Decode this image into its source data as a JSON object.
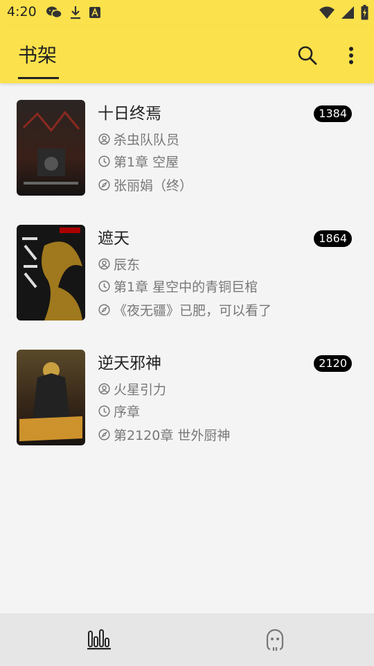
{
  "status_bar": {
    "time": "4:20",
    "left_icons": [
      "wechat-icon",
      "download-icon",
      "text-app-icon"
    ],
    "right_icons": [
      "wifi-icon",
      "signal-icon",
      "battery-charging-icon"
    ]
  },
  "app_bar": {
    "tab_label": "书架",
    "actions": [
      "search-icon",
      "more-vert-icon"
    ],
    "accent_color": "#fbe14b"
  },
  "books": [
    {
      "title": "十日终焉",
      "unread_count": "1384",
      "author": "杀虫队队员",
      "last_read": "第1章 空屋",
      "latest": "张丽娟（终）",
      "cover_colors": [
        "#1e1a18",
        "#5a1a14"
      ]
    },
    {
      "title": "遮天",
      "unread_count": "1864",
      "author": "辰东",
      "last_read": "第1章 星空中的青铜巨棺",
      "latest": "《夜无疆》已肥，可以看了",
      "cover_colors": [
        "#151515",
        "#c79a2a"
      ]
    },
    {
      "title": "逆天邪神",
      "unread_count": "2120",
      "author": "火星引力",
      "last_read": "序章",
      "latest": "第2120章 世外厨神",
      "cover_colors": [
        "#3a2a1a",
        "#e0a030"
      ]
    }
  ],
  "bottom_nav": {
    "items": [
      "bookshelf-icon",
      "discover-face-icon"
    ]
  }
}
